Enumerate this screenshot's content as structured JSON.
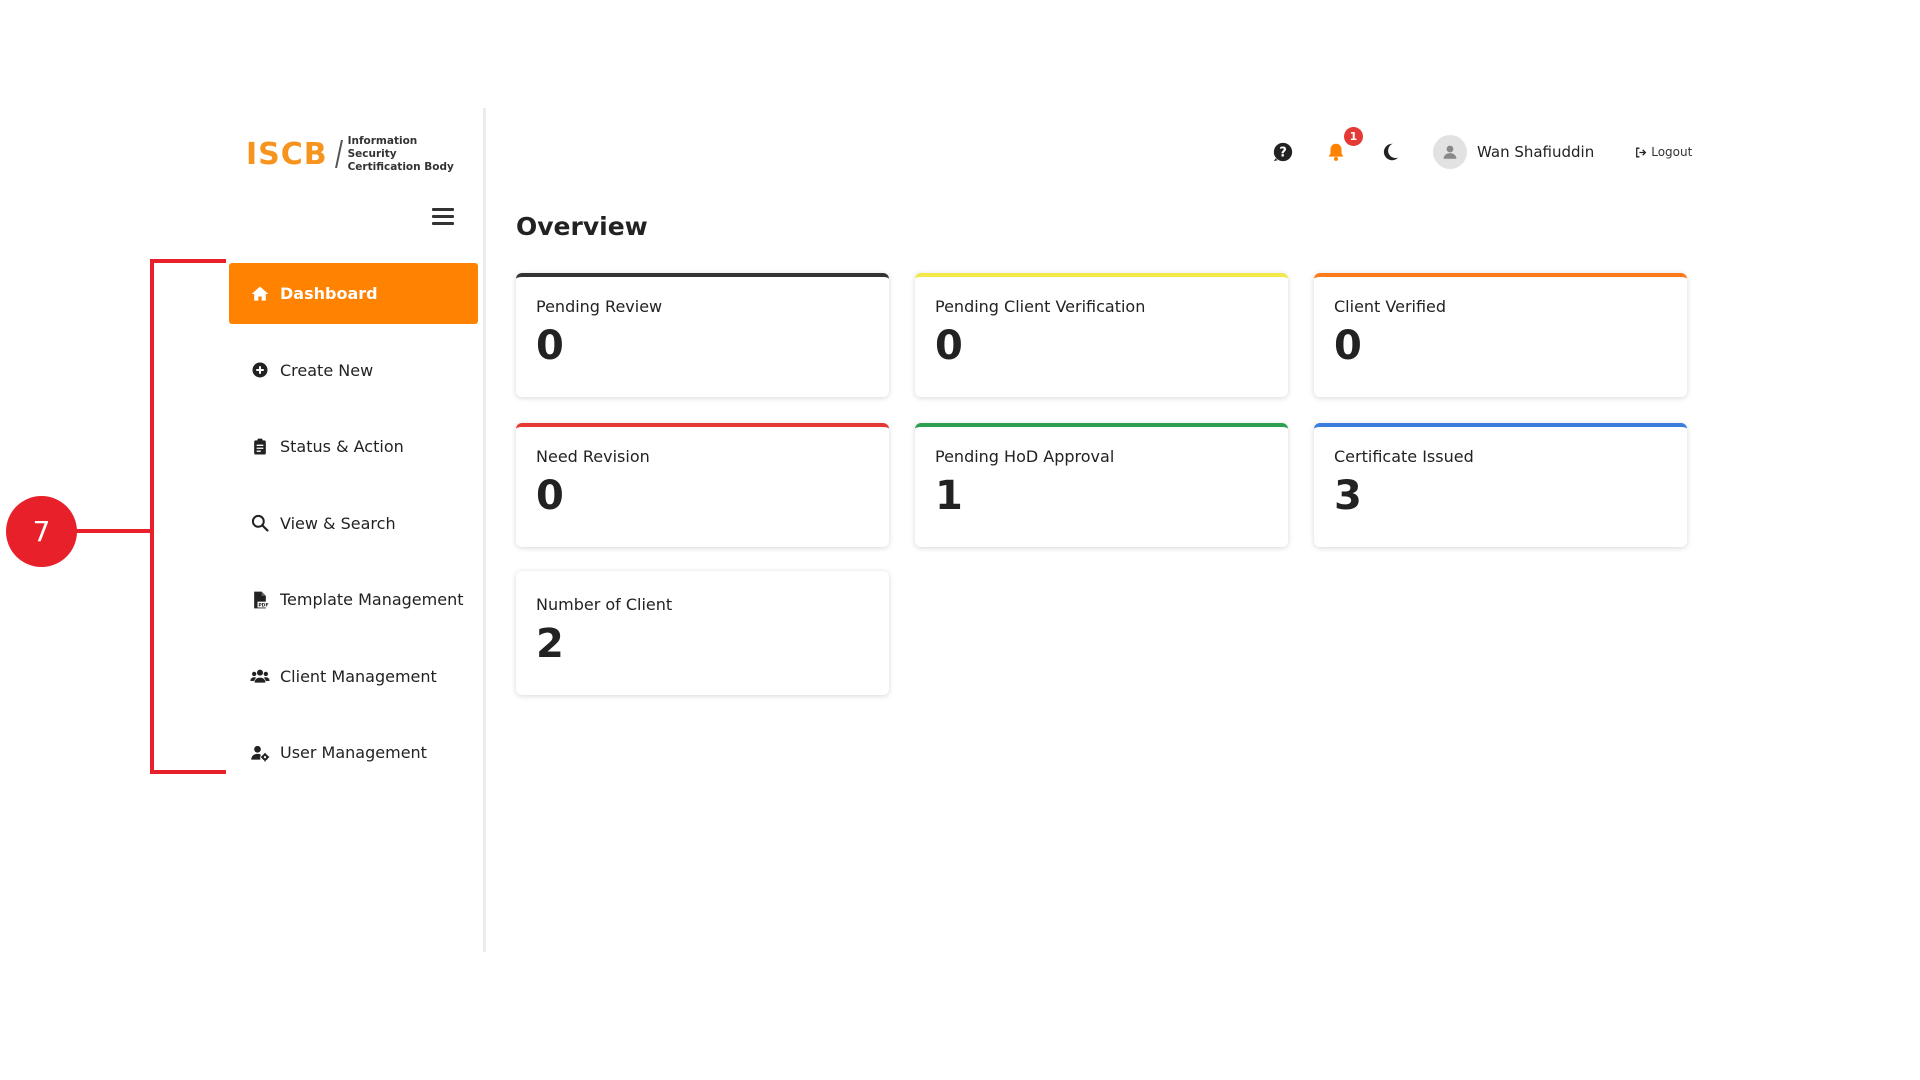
{
  "brand": {
    "logo_mark": "ISCB",
    "logo_line1": "Information Security",
    "logo_line2": "Certification Body",
    "accent": "#ff8200"
  },
  "sidebar": {
    "items": [
      {
        "label": "Dashboard",
        "icon": "home-icon",
        "active": true
      },
      {
        "label": "Create New",
        "icon": "plus-circle-icon"
      },
      {
        "label": "Status & Action",
        "icon": "clipboard-icon"
      },
      {
        "label": "View & Search",
        "icon": "search-icon"
      },
      {
        "label": "Template Management",
        "icon": "pdf-file-icon"
      },
      {
        "label": "Client Management",
        "icon": "users-icon"
      },
      {
        "label": "User Management",
        "icon": "user-gear-icon"
      }
    ]
  },
  "header": {
    "notification_count": "1",
    "username": "Wan Shafiuddin",
    "logout_label": "Logout"
  },
  "main": {
    "title": "Overview",
    "cards": [
      {
        "title": "Pending Review",
        "value": "0",
        "color": "#333333"
      },
      {
        "title": "Pending Client Verification",
        "value": "0",
        "color": "#f2e84a"
      },
      {
        "title": "Client Verified",
        "value": "0",
        "color": "#ff7a1a"
      },
      {
        "title": "Need Revision",
        "value": "0",
        "color": "#e53935"
      },
      {
        "title": "Pending HoD Approval",
        "value": "1",
        "color": "#2e9e4f"
      },
      {
        "title": "Certificate Issued",
        "value": "3",
        "color": "#3b7ddd"
      },
      {
        "title": "Number of Client",
        "value": "2",
        "color": "#ffffff"
      }
    ]
  },
  "annotation": {
    "callout_number": "7",
    "color": "#e8202a"
  }
}
